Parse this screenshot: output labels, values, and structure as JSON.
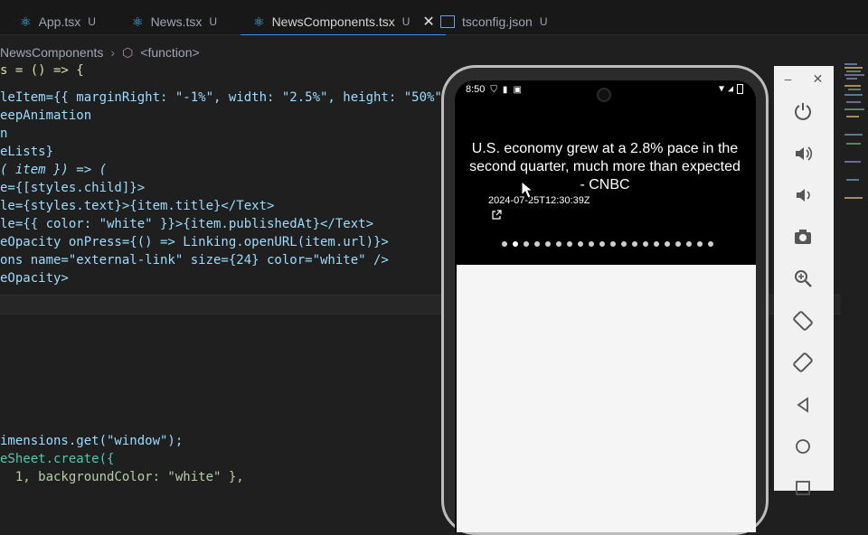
{
  "tabs": [
    {
      "label": "App.tsx",
      "status": "U"
    },
    {
      "label": "News.tsx",
      "status": "U"
    },
    {
      "label": "NewsComponents.tsx",
      "status": "U"
    },
    {
      "label": "tsconfig.json",
      "status": "U"
    }
  ],
  "breadcrumb": {
    "file": "NewsComponents",
    "symbol": "<function>"
  },
  "code": {
    "l1": [
      "s = () => {"
    ],
    "l2": [
      "leItem={{ marginRight: \"-1%\", width: \"2.5%\", height: \"50%\" }}"
    ],
    "l3": "eepAnimation",
    "l4": "n",
    "l5": "eLists}",
    "l6": "( item }) => (",
    "l7": "e={[styles.child]}>",
    "l8": "le={styles.text}>{item.title}</Text>",
    "l9": "le={{ color: \"white\" }}>{item.publishedAt}</Text>",
    "l10": "eOpacity onPress={() => Linking.openURL(item.url)}>",
    "l11": "ons name=\"external-link\" size={24} color=\"white\" />",
    "l12": "eOpacity>",
    "l13": "imensions.get(\"window\");",
    "l14": "eSheet.create({",
    "l15": "  1, backgroundColor: \"white\" },"
  },
  "phone": {
    "time": "8:50",
    "headline": "U.S. economy grew at a 2.8% pace in the second quarter, much more than expected - CNBC",
    "date": "2024-07-25T12:30:39Z",
    "dot_count": 20,
    "active_dot": 1
  },
  "emulator": {
    "minimize": "–",
    "close": "✕",
    "buttons": [
      "power-icon",
      "volume-up-icon",
      "volume-down-icon",
      "camera-icon",
      "zoom-icon",
      "rotate-left-icon",
      "rotate-right-icon",
      "back-icon",
      "home-icon",
      "overview-icon"
    ]
  },
  "colors": {
    "accent": "#3794ff",
    "editor_bg": "#1f1f1f"
  }
}
